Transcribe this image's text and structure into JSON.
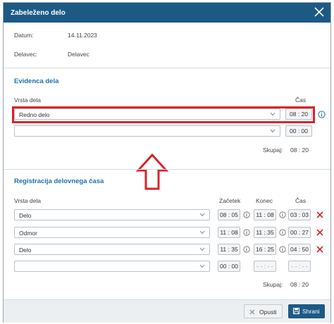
{
  "dialog": {
    "title": "Zabeleženo delo",
    "header": {
      "date_label": "Datum:",
      "date_value": "14.11.2023",
      "worker_label": "Delavec:",
      "worker_value": "Delavec"
    },
    "evidence": {
      "section_title": "Evidenca dela",
      "col_work_type": "Vrsta dela",
      "col_time": "Čas",
      "rows": [
        {
          "work_type": "Redno delo",
          "time": "08 : 20"
        },
        {
          "work_type": "",
          "time": "00 : 00"
        }
      ],
      "total_label": "Skupaj:",
      "total_value": "08 : 20"
    },
    "registration": {
      "section_title": "Registracija delovnega časa",
      "col_work_type": "Vrsta dela",
      "col_start": "Začetek",
      "col_end": "Konec",
      "col_time": "Čas",
      "rows": [
        {
          "work_type": "Delo",
          "start": "08 : 05",
          "end": "11 : 08",
          "time": "03 : 03"
        },
        {
          "work_type": "Odmor",
          "start": "11 : 08",
          "end": "11 : 35",
          "time": "00 : 27"
        },
        {
          "work_type": "Delo",
          "start": "11 : 35",
          "end": "16 : 25",
          "time": "04 : 50"
        },
        {
          "work_type": "",
          "start": "00 : 00",
          "end": "- - : - -",
          "time": "- - : - -"
        }
      ],
      "total_label": "Skupaj:",
      "total_value": "08 : 20"
    },
    "footer": {
      "cancel_label": "Opusti",
      "save_label": "Shrani"
    }
  },
  "colors": {
    "titlebar": "#1c5a85",
    "section_title": "#2170a8",
    "highlight": "#d9232d",
    "delete_icon": "#d9232d"
  }
}
